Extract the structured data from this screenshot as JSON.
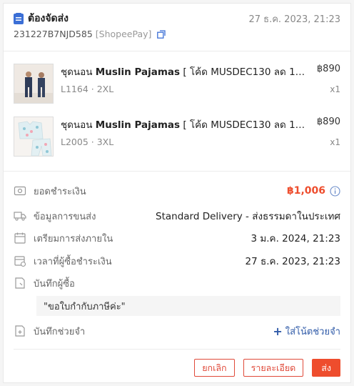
{
  "header": {
    "status": "ต้องจัดส่ง",
    "date": "27 ธ.ค. 2023, 21:23",
    "order_id": "231227B7NJD585",
    "payment_tag": "[ShopeePay]"
  },
  "products": [
    {
      "name_prefix": "ชุดนอน ",
      "name_bold": "Muslin Pajamas",
      "name_rest": " [ โค้ด MUSDEC130 ลด 130 ...",
      "variant": "L1164 · 2XL",
      "price": "฿890",
      "qty": "x1",
      "thumb_icon": "pajama-photo-navy"
    },
    {
      "name_prefix": "ชุดนอน ",
      "name_bold": "Muslin Pajamas",
      "name_rest": " [ โค้ด MUSDEC130 ลด 130 ...",
      "variant": "L2005 · 3XL",
      "price": "฿890",
      "qty": "x1",
      "thumb_icon": "pajama-photo-print"
    }
  ],
  "info": {
    "total_label": "ยอดชำระเงิน",
    "total_value": "฿1,006",
    "shipping_label": "ข้อมูลการขนส่ง",
    "shipping_value": "Standard Delivery - ส่งธรรมดาในประเทศ",
    "prepare_label": "เตรียมการส่งภายใน",
    "prepare_value": "3 ม.ค. 2024, 21:23",
    "ordered_label": "เวลาที่ผู้ซื้อชำระเงิน",
    "ordered_value": "27 ธ.ค. 2023, 21:23",
    "buyer_note_label": "บันทึกผู้ซื้อ",
    "buyer_note_value": "\"ขอใบกำกับภาษีค่ะ\"",
    "seller_note_label": "บันทึกช่วยจำ",
    "add_note_label": "ใส่โน้ตช่วยจำ"
  },
  "actions": {
    "cancel": "ยกเลิก",
    "details": "รายละเอียด",
    "ship": "ส่ง"
  },
  "colors": {
    "accent": "#ee4d2d",
    "link": "#2f5aa8",
    "status_icon": "#3b6fd6"
  }
}
